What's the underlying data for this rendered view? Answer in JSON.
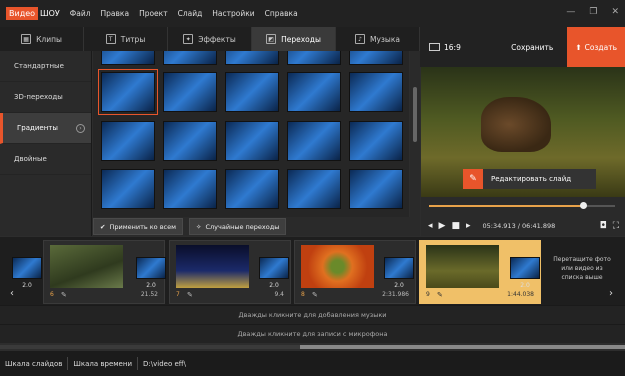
{
  "app": {
    "brand_part1": "Видео",
    "brand_part2": "ШОУ"
  },
  "menu": [
    "Файл",
    "Правка",
    "Проект",
    "Слайд",
    "Настройки",
    "Справка"
  ],
  "tabs": [
    {
      "label": "Клипы",
      "icon": "film-icon"
    },
    {
      "label": "Титры",
      "icon": "text-icon"
    },
    {
      "label": "Эффекты",
      "icon": "effects-icon"
    },
    {
      "label": "Переходы",
      "icon": "transition-icon",
      "active": true
    },
    {
      "label": "Музыка",
      "icon": "music-icon"
    }
  ],
  "categories": [
    "Стандартные",
    "3D-переходы",
    "Градиенты",
    "Двойные"
  ],
  "active_category": "Градиенты",
  "actions": {
    "apply_all": "Применить ко всем",
    "random": "Случайные переходы"
  },
  "header": {
    "ratio": "16:9",
    "save": "Сохранить",
    "create": "Создать"
  },
  "preview": {
    "edit_label": "Редактировать слайд"
  },
  "playback": {
    "time": "05:34.913 / 06:41.898",
    "progress": 0.83
  },
  "timeline": {
    "transitions_duration": "2.0",
    "slides": [
      {
        "num": "6",
        "dur": "21.52"
      },
      {
        "num": "7",
        "dur": "9.4"
      },
      {
        "num": "8",
        "dur": "2:31.986"
      },
      {
        "num": "9",
        "dur": "1:44.038",
        "selected": true
      }
    ],
    "drop_hint": "Перетащите фото или видео из списка выше"
  },
  "tracks": {
    "music": "Дважды кликните для добавления музыки",
    "mic": "Дважды кликните для записи с микрофона"
  },
  "bottom": {
    "slides_tab": "Шкала слайдов",
    "timeline_tab": "Шкала времени",
    "path": "D:\\video eff\\"
  },
  "colors": {
    "accent": "#e8552b",
    "selected_slide": "#f0c068"
  }
}
